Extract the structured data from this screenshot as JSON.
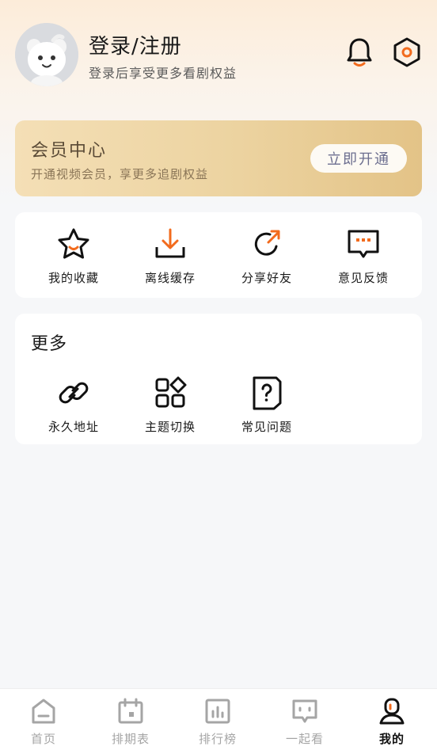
{
  "header": {
    "title": "登录/注册",
    "subtitle": "登录后享受更多看剧权益",
    "icons": [
      "avatar",
      "bell-icon",
      "settings-icon"
    ]
  },
  "vip": {
    "title": "会员中心",
    "subtitle": "开通视频会员，享更多追剧权益",
    "button": "立即开通"
  },
  "quick_actions": [
    {
      "label": "我的收藏",
      "icon": "star-icon"
    },
    {
      "label": "离线缓存",
      "icon": "download-icon"
    },
    {
      "label": "分享好友",
      "icon": "share-icon"
    },
    {
      "label": "意见反馈",
      "icon": "feedback-icon"
    }
  ],
  "more": {
    "title": "更多",
    "items": [
      {
        "label": "永久地址",
        "icon": "link-icon"
      },
      {
        "label": "主题切换",
        "icon": "theme-icon"
      },
      {
        "label": "常见问题",
        "icon": "faq-icon"
      }
    ]
  },
  "tabbar": [
    {
      "label": "首页",
      "icon": "home-icon",
      "active": false
    },
    {
      "label": "排期表",
      "icon": "calendar-icon",
      "active": false
    },
    {
      "label": "排行榜",
      "icon": "ranking-icon",
      "active": false
    },
    {
      "label": "一起看",
      "icon": "watch-together-icon",
      "active": false
    },
    {
      "label": "我的",
      "icon": "profile-icon",
      "active": true
    }
  ],
  "colors": {
    "accent": "#f26b1d",
    "vip_gradient_start": "#f4dfb6",
    "vip_gradient_end": "#e3c387",
    "tab_inactive": "#a5a5a5",
    "tab_active": "#111111"
  }
}
